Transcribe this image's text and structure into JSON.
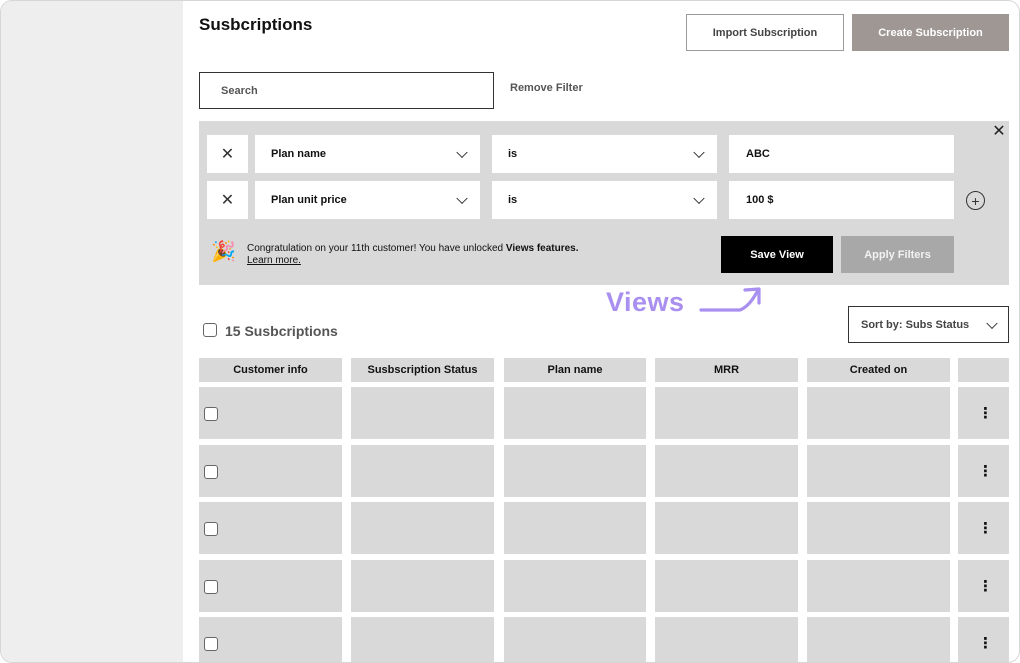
{
  "page": {
    "title": "Susbcriptions",
    "import_label": "Import Subscription",
    "create_label": "Create Subscription"
  },
  "search": {
    "placeholder": "Search",
    "remove_filter_label": "Remove Filter"
  },
  "filters": {
    "rows": [
      {
        "field": "Plan name",
        "operator": "is",
        "value": "ABC"
      },
      {
        "field": "Plan unit price",
        "operator": "is",
        "value": "100 $"
      }
    ],
    "banner_text": "Congratulation on your 11th customer! You have unlocked ",
    "banner_bold": "Views features.",
    "learn_more": "Learn more.",
    "save_view_label": "Save View",
    "apply_filters_label": "Apply Filters"
  },
  "annotation": {
    "label": "Views",
    "color": "#a98ff0"
  },
  "list": {
    "count_label": "15 Susbcriptions",
    "sort_label": "Sort by: Subs Status"
  },
  "table": {
    "columns": [
      "Customer info",
      "Susbscription Status",
      "Plan name",
      "MRR",
      "Created on",
      ""
    ],
    "row_count": 5
  },
  "colors": {
    "sidebar": "#eeeeee",
    "panel": "#d9d9d9",
    "primary_dark": "#000000",
    "create_button": "#9e9794",
    "disabled_button": "#a8a8a8"
  }
}
